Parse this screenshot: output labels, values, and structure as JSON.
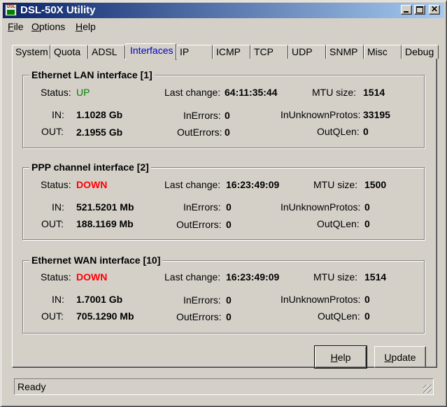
{
  "window": {
    "title": "DSL-50X Utility",
    "icon_text": "DSL"
  },
  "menu": [
    {
      "label": "File",
      "accel": "F",
      "rest": "ile"
    },
    {
      "label": "Options",
      "accel": "O",
      "rest": "ptions"
    },
    {
      "label": "Help",
      "accel": "H",
      "rest": "elp"
    }
  ],
  "tabs": [
    "System",
    "Quota",
    "ADSL",
    "Interfaces",
    "IP",
    "ICMP",
    "TCP",
    "UDP",
    "SNMP",
    "Misc",
    "Debug"
  ],
  "active_tab": "Interfaces",
  "labels": {
    "status": "Status:",
    "last_change": "Last change:",
    "mtu": "MTU size:",
    "in": "IN:",
    "out": "OUT:",
    "in_errors": "InErrors:",
    "out_errors": "OutErrors:",
    "in_unknown": "InUnknownProtos:",
    "out_qlen": "OutQLen:"
  },
  "interfaces": [
    {
      "title": "Ethernet LAN interface [1]",
      "status": "UP",
      "last_change": "64:11:35:44",
      "mtu": "1514",
      "in": "1.1028 Gb",
      "out": "2.1955 Gb",
      "in_errors": "0",
      "out_errors": "0",
      "in_unknown": "33195",
      "out_qlen": "0"
    },
    {
      "title": "PPP channel interface [2]",
      "status": "DOWN",
      "last_change": "16:23:49:09",
      "mtu": "1500",
      "in": "521.5201 Mb",
      "out": "188.1169 Mb",
      "in_errors": "0",
      "out_errors": "0",
      "in_unknown": "0",
      "out_qlen": "0"
    },
    {
      "title": "Ethernet WAN interface [10]",
      "status": "DOWN",
      "last_change": "16:23:49:09",
      "mtu": "1514",
      "in": "1.7001 Gb",
      "out": "705.1290 Mb",
      "in_errors": "0",
      "out_errors": "0",
      "in_unknown": "0",
      "out_qlen": "0"
    }
  ],
  "buttons": {
    "help": {
      "label": "Help",
      "accel": "H",
      "rest": "elp"
    },
    "update": {
      "label": "Update",
      "accel": "U",
      "rest": "pdate"
    }
  },
  "status_bar": "Ready",
  "colors": {
    "status_up": "#008000",
    "status_down": "#ff0000",
    "active_tab": "#0000c0",
    "titlebar_start": "#0a246a",
    "titlebar_end": "#a6caf0"
  }
}
